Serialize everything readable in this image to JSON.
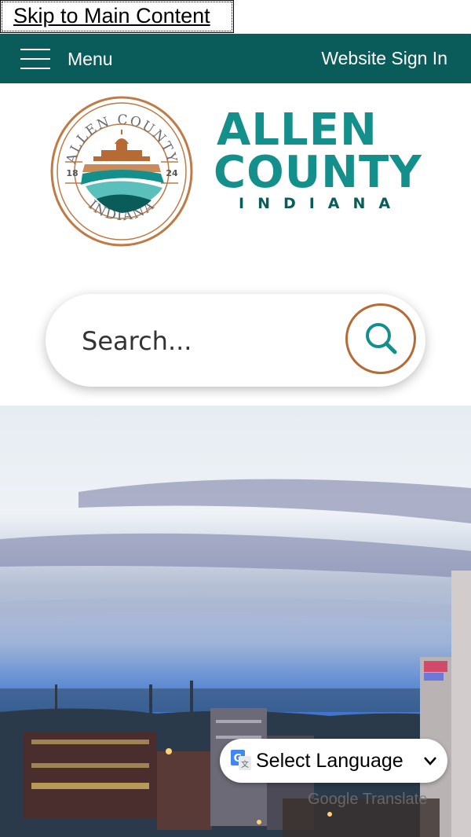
{
  "skip_link": "Skip to Main Content",
  "topbar": {
    "menu_label": "Menu",
    "sign_in": "Website Sign In",
    "bg_color": "#0a5c5a"
  },
  "logo": {
    "seal_top": "ALLEN COUNTY",
    "seal_bottom": "INDIANA",
    "seal_year_left": "18",
    "seal_year_right": "24",
    "word_line1": "ALLEN",
    "word_line2": "COUNTY",
    "word_line3": "INDIANA",
    "brand_teal": "#14908c",
    "brand_copper": "#c07a45"
  },
  "search": {
    "placeholder": "Search..."
  },
  "translate": {
    "selected": "Select Language",
    "powered_by": "Google Translate"
  },
  "hero": {
    "subject": "city-skyline-dusk"
  }
}
